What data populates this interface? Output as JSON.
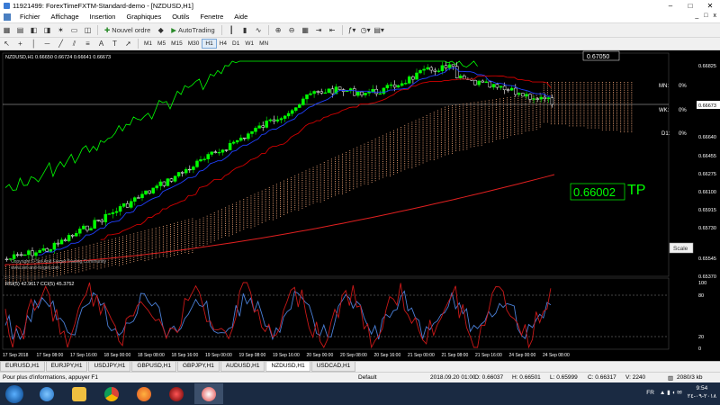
{
  "window": {
    "title": "11921499: ForexTimeFXTM-Standard-demo - [NZDUSD,H1]",
    "minimize": "–",
    "maximize": "□",
    "close": "✕"
  },
  "menu": {
    "items": [
      "Fichier",
      "Affichage",
      "Insertion",
      "Graphiques",
      "Outils",
      "Fenetre",
      "Aide"
    ],
    "mdi_buttons": [
      "_",
      "□",
      "x"
    ]
  },
  "toolbar": {
    "new_order_label": "Nouvel ordre",
    "autotrading_label": "AutoTrading"
  },
  "timeframes": [
    "M1",
    "M5",
    "M15",
    "M30",
    "H1",
    "H4",
    "D1",
    "W1",
    "MN"
  ],
  "active_timeframe": "H1",
  "chart": {
    "header": "NZDUSD,H1  0.66650 0.66724 0.66641 0.66673",
    "watermark": [
      "Copyright © Set And Forget Trading Community",
      "www.set-and-forget.com"
    ],
    "current_price_box": "0.67050",
    "levels": [
      {
        "label": "MN:",
        "value": "0%"
      },
      {
        "label": "WK:",
        "value": "0%"
      },
      {
        "label": "D1:",
        "value": "0%"
      }
    ],
    "tp_price": "0.66002",
    "tp_label": "TP",
    "scale_button": "Scale",
    "price_axis": [
      "0.66825",
      "0.66673",
      "0.66640",
      "0.66455",
      "0.66275",
      "0.66100",
      "0.65915",
      "0.65730",
      "0.65545",
      "0.65370",
      "0.67050"
    ],
    "rsi_header": "RSI(5) 42.9617  CCI(5) 45.3752",
    "rsi_levels": [
      "100",
      "80",
      "20",
      "0"
    ],
    "time_axis": [
      "17 Sep 2018",
      "17 Sep 08:00",
      "17 Sep 16:00",
      "18 Sep 00:00",
      "18 Sep 08:00",
      "18 Sep 16:00",
      "19 Sep 00:00",
      "19 Sep 08:00",
      "19 Sep 16:00",
      "20 Sep 00:00",
      "20 Sep 08:00",
      "20 Sep 16:00",
      "21 Sep 00:00",
      "21 Sep 08:00",
      "21 Sep 16:00",
      "24 Sep 00:00",
      "24 Sep 08:00"
    ]
  },
  "tabs": [
    "EURUSD,H1",
    "EURJPY,H1",
    "USDJPY,H1",
    "GBPUSD,H1",
    "GBPJPY,H1",
    "AUDUSD,H1",
    "NZDUSD,H1",
    "USDCAD,H1"
  ],
  "active_tab": "NZDUSD,H1",
  "status": {
    "help": "Pour plus d'informations, appuyer F1",
    "profile": "Default",
    "datetime": "2018.09.20 01:00",
    "open": "O: 0.66037",
    "high": "H: 0.66501",
    "low": "L: 0.65999",
    "close": "C: 0.66317",
    "volume": "V: 2240",
    "traffic": "2080/3 kb"
  },
  "taskbar": {
    "lang": "FR",
    "time": "9:54",
    "date": "٢٠١٨-٠٩-٢٤"
  },
  "colors": {
    "background": "#000000",
    "candle_up": "#00ff00",
    "candle_down": "#ffffff",
    "ichimoku_cloud": "#ffb080",
    "chikou": "#00ff00",
    "kijun": "#d00000",
    "tenkan": "#2040ff",
    "ma_long": "#e02020",
    "rsi": "#4a7fd6",
    "cci": "#c81818",
    "tp": "#00ff00"
  }
}
